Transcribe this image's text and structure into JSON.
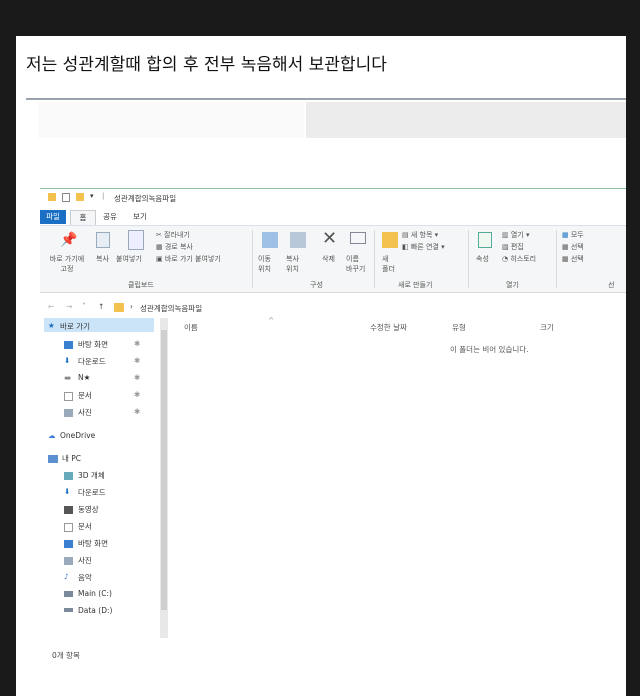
{
  "post": {
    "heading": "저는 성관계할때 합의 후 전부 녹음해서 보관합니다"
  },
  "explorer": {
    "title": "성관계합의녹음파일",
    "tabs": [
      "파일",
      "홈",
      "공유",
      "보기"
    ],
    "ribbon": {
      "pin_label": "바로 가기에\n고정",
      "copy_label": "복사",
      "paste_label": "붙여넣기",
      "cut_label": "잘라내기",
      "copy_path_label": "경로 복사",
      "paste_shortcut_label": "바로 가기 붙여넣기",
      "group_clipboard": "클립보드",
      "move_to_label": "이동\n위치",
      "copy_to_label": "복사\n위치",
      "delete_label": "삭제",
      "rename_label": "이름\n바꾸기",
      "group_organize": "구성",
      "new_folder_label": "새\n폴더",
      "new_item_label": "새 항목",
      "easy_access_label": "빠른 연결",
      "group_new": "새로 만들기",
      "properties_label": "속성",
      "open_label": "열기",
      "edit_label": "편집",
      "history_label": "히스토리",
      "group_open": "열기",
      "select_all_label": "모두",
      "select_none_label": "선택",
      "invert_label": "선택",
      "group_select": "선"
    },
    "address_path": "성관계합의녹음파일",
    "columns": {
      "name": "이름",
      "modified": "수정한 날짜",
      "type": "유형",
      "size": "크기"
    },
    "empty_message": "이 폴더는 비어 있습니다.",
    "nav": {
      "quick_access": "바로 가기",
      "quick_items": [
        "바탕 화면",
        "다운로드",
        "N★",
        "문서",
        "사진"
      ],
      "onedrive": "OneDrive",
      "this_pc": "내 PC",
      "pc_items": [
        "3D 개체",
        "다운로드",
        "동영상",
        "문서",
        "바탕 화면",
        "사진",
        "음악",
        "Main (C:)",
        "Data (D:)"
      ]
    },
    "item_count": "0개 항목"
  },
  "colors": {
    "file_tab": "#1a6fc4",
    "nav_selected": "#cce4f7",
    "folder": "#f2c14e"
  }
}
